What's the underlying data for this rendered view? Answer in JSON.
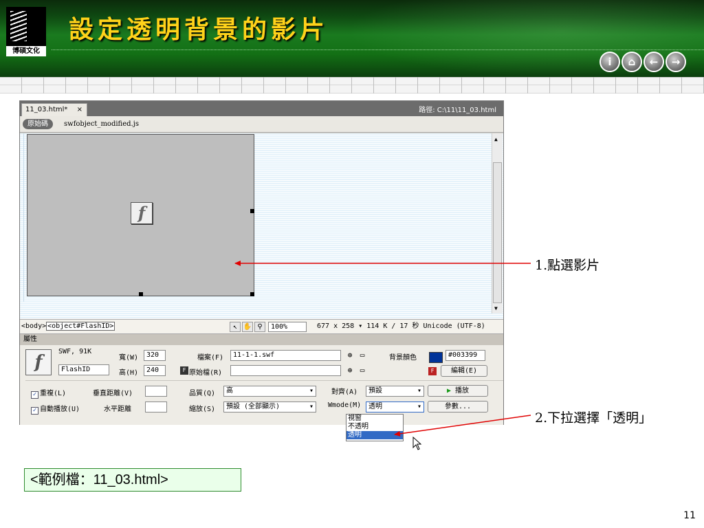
{
  "slide": {
    "title": "設定透明背景的影片",
    "logo_text": "博碩文化",
    "nav_buttons": [
      "i",
      "⌂",
      "←",
      "→"
    ],
    "nav_icons": [
      "info-icon",
      "home-icon",
      "back-icon",
      "forward-icon"
    ],
    "page_number": "11",
    "example_label": "<範例檔：11_03.html>",
    "annotations": {
      "step1": "1.點選影片",
      "step2": "2.下拉選擇「透明」"
    },
    "colors": {
      "title": "#ffd21a",
      "header_green": "#1a7a1f",
      "arrow": "#e00000",
      "example_bg": "#eaffea"
    }
  },
  "dw": {
    "doc_tab": "11_03.html*",
    "tab_close": "×",
    "path": "路徑: C:\\11\\11_03.html",
    "source_button": "原始碼",
    "related_file": "swfobject_modified.js",
    "status": {
      "tag_body": "<body>",
      "tag_object": "<object#FlashID>",
      "zoom": "100%",
      "dims": "677 x 258 ▾ 114 K / 17 秒 Unicode (UTF-8)"
    },
    "props_title": "屬性",
    "props": {
      "swf_info": "SWF, 91K",
      "id_value": "FlashID",
      "width_label": "寬(W)",
      "width_value": "320",
      "height_label": "高(H)",
      "height_value": "240",
      "file_label": "檔案(F)",
      "file_value": "11-1-1.swf",
      "src_label": "原始檔(R)",
      "src_value": "",
      "bg_label": "背景顏色",
      "bg_color": "#003399",
      "bg_value": "#003399",
      "edit_button": "編輯(E)",
      "loop_label": "重複(L)",
      "autoplay_label": "自動播放(U)",
      "vspace_label": "垂直距離(V)",
      "hspace_label": "水平距離",
      "quality_label": "品質(Q)",
      "quality_value": "高",
      "scale_label": "縮放(S)",
      "scale_value": "預設 (全部顯示)",
      "align_label": "對齊(A)",
      "align_value": "預設",
      "wmode_label": "Wmode(M)",
      "wmode_value": "透明",
      "play_button": "播放",
      "params_button": "參數...",
      "wmode_options": [
        "視窗",
        "不透明",
        "透明"
      ]
    }
  }
}
